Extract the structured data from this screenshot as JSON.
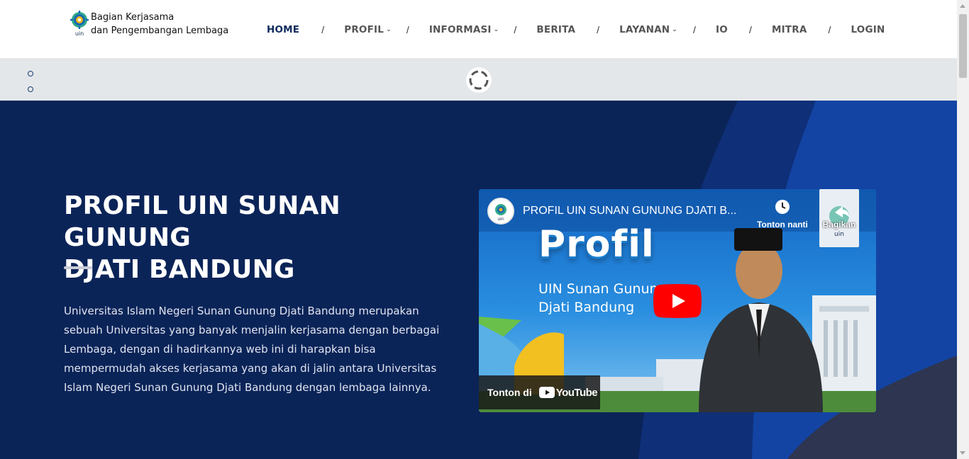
{
  "header": {
    "logo": {
      "line1": "Bagian Kerjasama",
      "line2": "dan Pengembangan Lembaga",
      "icon": "uin-logo-icon"
    },
    "nav": [
      {
        "label": "HOME",
        "active": true,
        "dropdown": false
      },
      {
        "label": "PROFIL",
        "active": false,
        "dropdown": true
      },
      {
        "label": "INFORMASI",
        "active": false,
        "dropdown": true
      },
      {
        "label": "BERITA",
        "active": false,
        "dropdown": false
      },
      {
        "label": "LAYANAN",
        "active": false,
        "dropdown": true
      },
      {
        "label": "IO",
        "active": false,
        "dropdown": false
      },
      {
        "label": "MITRA",
        "active": false,
        "dropdown": false
      },
      {
        "label": "LOGIN",
        "active": false,
        "dropdown": false
      }
    ],
    "separator": "/",
    "dropdown_icon": "chevron-down-icon"
  },
  "slider": {
    "indicator_count": 2,
    "loading_icon": "spinner-icon"
  },
  "hero": {
    "title_line1": "PROFIL UIN SUNAN GUNUNG",
    "title_line2": "DJATI BANDUNG",
    "description": "Universitas Islam Negeri Sunan Gunung Djati Bandung merupakan sebuah Universitas yang banyak menjalin kerjasama dengan berbagai Lembaga, dengan di hadirkannya web ini di harapkan bisa mempermudah akses kerjasama yang akan di jalin antara Universitas Islam Negeri Sunan Gunung Djati Bandung dengan lembaga lainnya."
  },
  "video": {
    "title": "PROFIL UIN SUNAN GUNUNG DJATI B...",
    "watch_later": "Tonton nanti",
    "share": "Bagikan",
    "thumbnail_title": "Profil",
    "thumbnail_subtitle_line1": "UIN Sunan Gunung",
    "thumbnail_subtitle_line2": "Djati Bandung",
    "watch_on": "Tonton di",
    "youtube": "YouTube"
  },
  "colors": {
    "navy": "#0b2458",
    "active_nav": "#0d2a5c",
    "nav_text": "#555555",
    "slider_bg": "#e4e7e9",
    "youtube_red": "#ff0000"
  }
}
